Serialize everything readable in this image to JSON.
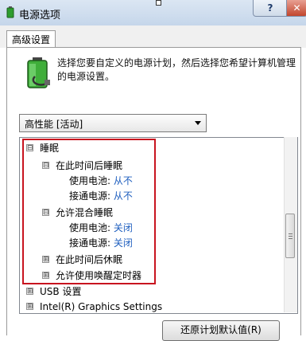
{
  "window": {
    "title": "电源选项",
    "help_label": "?",
    "close_label": "✕"
  },
  "tabs": [
    {
      "label": "高级设置"
    }
  ],
  "description": "选择您要自定义的电源计划，然后选择您希望计算机管理的电源设置。",
  "plan_select": {
    "value": "高性能 [活动]"
  },
  "tree": {
    "items": [
      {
        "label": "睡眠",
        "expander": "⊟"
      },
      {
        "label": "在此时间后睡眠",
        "expander": "⊟"
      },
      {
        "label": "使用电池:",
        "value": "从不"
      },
      {
        "label": "接通电源:",
        "value": "从不"
      },
      {
        "label": "允许混合睡眠",
        "expander": "⊟"
      },
      {
        "label": "使用电池:",
        "value": "关闭"
      },
      {
        "label": "接通电源:",
        "value": "关闭"
      },
      {
        "label": "在此时间后休眠",
        "expander": "⊞"
      },
      {
        "label": "允许使用唤醒定时器",
        "expander": "⊞"
      },
      {
        "label": "USB 设置",
        "expander": "⊞"
      },
      {
        "label": "Intel(R) Graphics Settings",
        "expander": "⊞"
      }
    ]
  },
  "buttons": {
    "restore_defaults": "还原计划默认值(R)"
  },
  "colors": {
    "link": "#1f5fbf",
    "highlight": "#c8141f"
  }
}
